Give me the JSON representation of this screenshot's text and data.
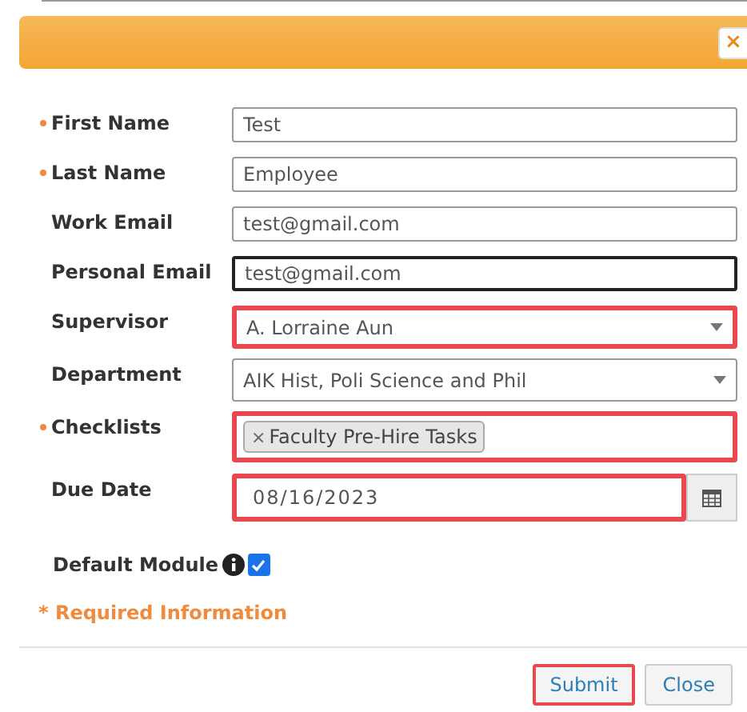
{
  "header": {
    "close": "×"
  },
  "fields": [
    {
      "label": "First Name",
      "kind": "text",
      "required": true,
      "value": "Test",
      "highlighted": false,
      "focused": false
    },
    {
      "label": "Last Name",
      "kind": "text",
      "required": true,
      "value": "Employee",
      "highlighted": false,
      "focused": false
    },
    {
      "label": "Work Email",
      "kind": "text",
      "required": false,
      "value": "test@gmail.com",
      "highlighted": false,
      "focused": false
    },
    {
      "label": "Personal Email",
      "kind": "text",
      "required": false,
      "value": "test@gmail.com",
      "highlighted": false,
      "focused": true
    },
    {
      "label": "Supervisor",
      "kind": "select",
      "required": false,
      "value": "A. Lorraine Aun",
      "highlighted": true,
      "focused": false
    },
    {
      "label": "Department",
      "kind": "select",
      "required": false,
      "value": "AIK Hist, Poli Science and Phil",
      "highlighted": false,
      "focused": false
    },
    {
      "label": "Checklists",
      "kind": "tags",
      "required": true,
      "tags": [
        {
          "remove": "×",
          "label": "Faculty Pre-Hire Tasks"
        }
      ],
      "highlighted": true,
      "focused": false
    },
    {
      "label": "Due Date",
      "kind": "date",
      "required": false,
      "value": "08/16/2023",
      "highlighted": true,
      "focused": false
    }
  ],
  "default_module": {
    "label": "Default Module",
    "checked": true
  },
  "required_note": "* Required Information",
  "buttons": [
    {
      "label": "Submit",
      "highlighted": true
    },
    {
      "label": "Close",
      "highlighted": false
    }
  ]
}
